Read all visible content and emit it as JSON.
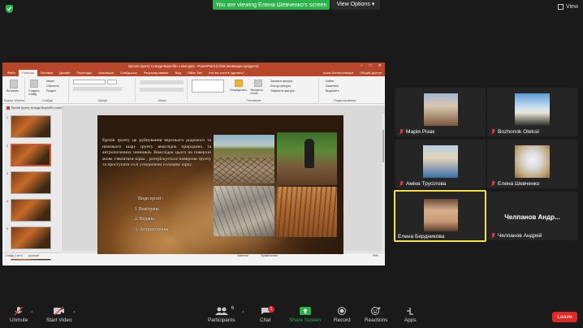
{
  "top": {
    "banner": "You are viewing Елена Шевченко's screen",
    "view_options": "View Options",
    "view": "View"
  },
  "ppt": {
    "title": "Ерозія ґрунту та води Воротбін з нею.pptx - PowerPoint (Сбой активации продукта)",
    "tabs": [
      "Файл",
      "Главная",
      "Вставка",
      "Дизайн",
      "Переходы",
      "Анимация",
      "Слайд-шоу",
      "Рецензирование",
      "Вид",
      "Office Tab",
      "Что вы хотите сделать?"
    ],
    "user": "Anna Dombrovskaya",
    "share": "Общий доступ",
    "groups": [
      "Буфер обмена",
      "Слайды",
      "Шрифт",
      "Абзац",
      "Рисование",
      "Редактирование"
    ],
    "ribbon_items": [
      "Вставить",
      "Создать слайд",
      "Макет",
      "Сбросить",
      "Раздел",
      "Упорядочить",
      "Экспресс-стили",
      "Заливка фигуры",
      "Контур фигуры",
      "Эффекты фигуры",
      "Найти",
      "Заменить",
      "Выделить"
    ],
    "file_tab": "Ерозія ґрунту та води Воротбін з нею.pptx",
    "status_slide": "Слайд 2 из 6",
    "status_lang": "русский",
    "status_notes": "Заметки",
    "status_comments": "Примечания",
    "zoom": "99%"
  },
  "slide": {
    "paragraph": "Ерозія ґрунту це руйнування верхнього родючого та нижнього шару ґрунту внаслідок природних та антропогенних чинників. Внаслідок цього на поверхні може з'являтися кірка , розтріскується поверхня ґрунту та проступати солі утворюючи солоцеву кірку.",
    "types_title": "Види ерозії :",
    "types": [
      "1 Повітряна",
      "2. Водяна",
      "3. Антропогенна"
    ]
  },
  "participants": [
    {
      "name": "Марія Різак"
    },
    {
      "name": "Bozhonok Oleksii"
    },
    {
      "name": "Аміна Трусілова"
    },
    {
      "name": "Елена  Шевченко"
    },
    {
      "name": "Елена Бердникова"
    },
    {
      "name": "Челпанов Андрей",
      "short": "Челпанов  Андр..."
    }
  ],
  "toolbar": {
    "unmute": "Unmute",
    "start_video": "Start Video",
    "participants": "Participants",
    "participants_count": "6",
    "chat": "Chat",
    "chat_badge": "1",
    "share_screen": "Share Screen",
    "record": "Record",
    "reactions": "Reactions",
    "apps": "Apps",
    "leave": "Leave"
  },
  "colors": {
    "accent_green": "#2db14a",
    "ppt_red": "#b7472a",
    "leave_red": "#e02828",
    "active_border": "#f5e23c"
  }
}
